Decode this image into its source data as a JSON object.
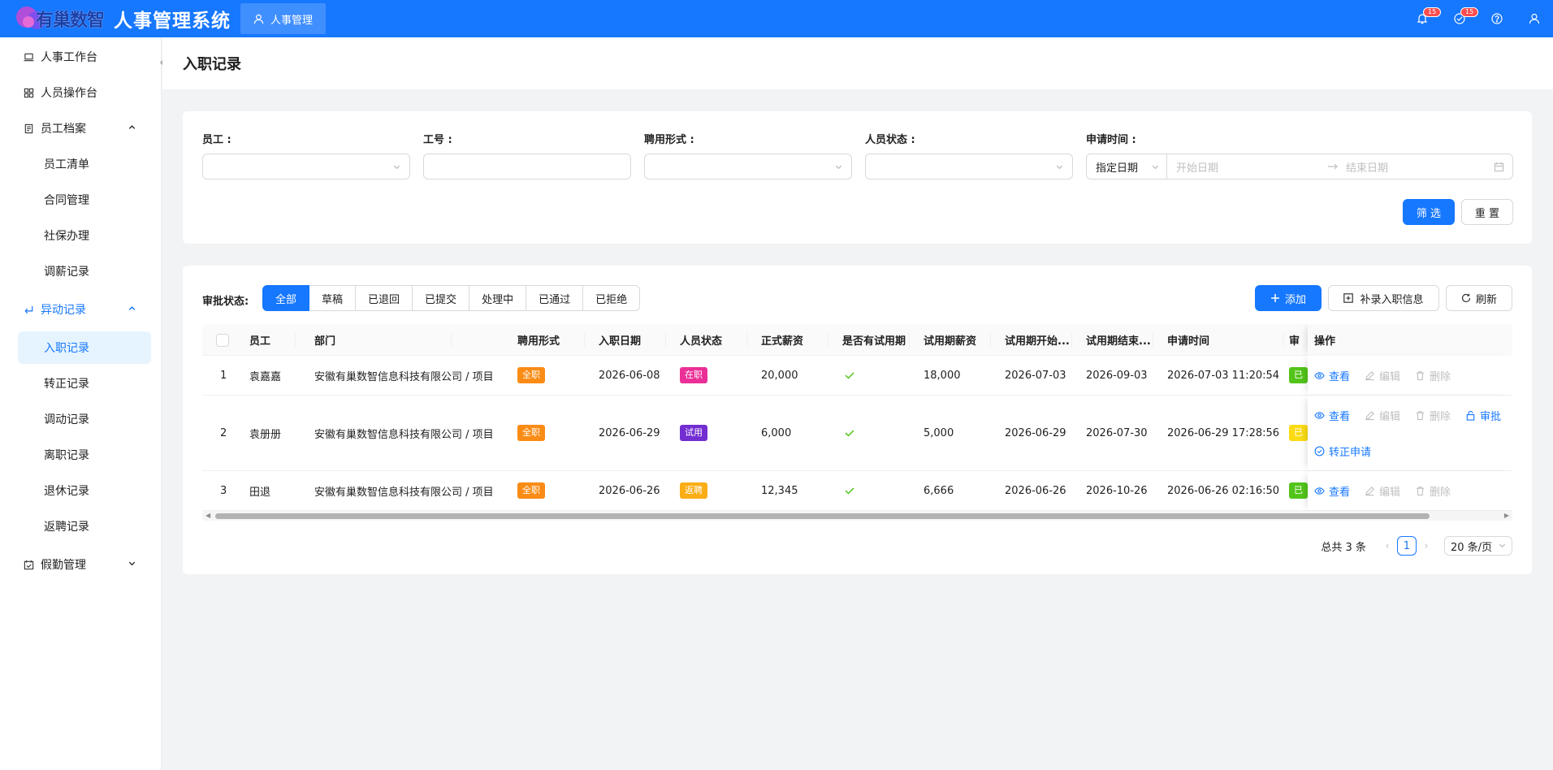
{
  "header": {
    "logo_text": "有巢数智",
    "system_title": "人事管理系统",
    "active_tab": "人事管理",
    "badges": [
      "15",
      "15"
    ]
  },
  "sidebar": {
    "items": [
      {
        "label": "人事工作台",
        "icon": "laptop-icon"
      },
      {
        "label": "人员操作台",
        "icon": "grid-icon"
      },
      {
        "label": "员工档案",
        "icon": "file-icon",
        "expanded": true,
        "children": [
          "员工清单",
          "合同管理",
          "社保办理",
          "调薪记录"
        ]
      },
      {
        "label": "异动记录",
        "icon": "enter-icon",
        "expanded": true,
        "children": [
          "入职记录",
          "转正记录",
          "调动记录",
          "离职记录",
          "退休记录",
          "返聘记录"
        ]
      },
      {
        "label": "假勤管理",
        "icon": "calendar-check-icon",
        "expanded": false
      }
    ],
    "active_child": "入职记录"
  },
  "page": {
    "title": "入职记录"
  },
  "filters": {
    "employee_label": "员工 :",
    "employee_no_label": "工号 :",
    "employment_type_label": "聘用形式 :",
    "person_status_label": "人员状态 :",
    "apply_time_label": "申请时间 :",
    "date_mode": "指定日期",
    "start_placeholder": "开始日期",
    "end_placeholder": "结束日期",
    "filter_button": "筛 选",
    "reset_button": "重 置"
  },
  "approval": {
    "label": "审批状态:",
    "options": [
      "全部",
      "草稿",
      "已退回",
      "已提交",
      "处理中",
      "已通过",
      "已拒绝"
    ],
    "active": "全部"
  },
  "toolbar": {
    "add": "添加",
    "supplement": "补录入职信息",
    "refresh": "刷新"
  },
  "table": {
    "columns": [
      "员工",
      "部门",
      "聘用形式",
      "入职日期",
      "人员状态",
      "正式薪资",
      "是否有试用期",
      "试用期薪资",
      "试用期开始...",
      "试用期结束...",
      "申请时间",
      "审",
      "操作"
    ],
    "rows": [
      {
        "no": "1",
        "employee": "袁嘉嘉",
        "dept": "安徽有巢数智信息科技有限公司 / 项目",
        "type": "全职",
        "join_date": "2026-06-08",
        "status": "在职",
        "status_color": "#eb2f96",
        "salary": "20,000",
        "has_probation": true,
        "probation_salary": "18,000",
        "probation_start": "2026-07-03",
        "probation_end": "2026-09-03",
        "apply_time": "2026-07-03 11:20:54",
        "approval_color": "#52c41a",
        "approval_char": "已",
        "ops": [
          "查看",
          "编辑",
          "删除"
        ]
      },
      {
        "no": "2",
        "employee": "袁册册",
        "dept": "安徽有巢数智信息科技有限公司 / 项目",
        "type": "全职",
        "join_date": "2026-06-29",
        "status": "试用",
        "status_color": "#722ed1",
        "salary": "6,000",
        "has_probation": true,
        "probation_salary": "5,000",
        "probation_start": "2026-06-29",
        "probation_end": "2026-07-30",
        "apply_time": "2026-06-29 17:28:56",
        "approval_color": "#fadb14",
        "approval_char": "已",
        "ops": [
          "查看",
          "编辑",
          "删除",
          "审批"
        ],
        "ops2": "转正申请"
      },
      {
        "no": "3",
        "employee": "田退",
        "dept": "安徽有巢数智信息科技有限公司 / 项目",
        "type": "全职",
        "join_date": "2026-06-26",
        "status": "返聘",
        "status_color": "#faad14",
        "salary": "12,345",
        "has_probation": true,
        "probation_salary": "6,666",
        "probation_start": "2026-06-26",
        "probation_end": "2026-10-26",
        "apply_time": "2026-06-26 02:16:50",
        "approval_color": "#52c41a",
        "approval_char": "已",
        "ops": [
          "查看",
          "编辑",
          "删除"
        ]
      }
    ]
  },
  "pagination": {
    "total": "总共 3 条",
    "page": "1",
    "page_size": "20 条/页"
  },
  "colors": {
    "primary": "#1677ff",
    "tag_fulltime": "#fa8c16"
  }
}
